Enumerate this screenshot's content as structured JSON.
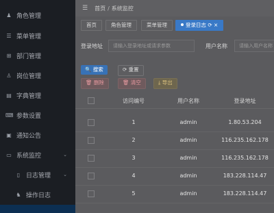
{
  "sidebar": {
    "items": [
      {
        "label": "角色管理",
        "icon": "user-group-icon"
      },
      {
        "label": "菜单管理",
        "icon": "menu-tree-icon"
      },
      {
        "label": "部门管理",
        "icon": "org-icon"
      },
      {
        "label": "岗位管理",
        "icon": "post-icon"
      },
      {
        "label": "字典管理",
        "icon": "dict-icon"
      },
      {
        "label": "参数设置",
        "icon": "settings-icon"
      },
      {
        "label": "通知公告",
        "icon": "notice-icon"
      },
      {
        "label": "系统监控",
        "icon": "monitor-icon"
      },
      {
        "label": "日志管理",
        "icon": "log-icon"
      },
      {
        "label": "操作日志",
        "icon": "operation-log-icon"
      }
    ]
  },
  "topbar": {
    "breadcrumb": [
      "首页",
      "系统监控"
    ]
  },
  "tags": [
    {
      "label": "首页"
    },
    {
      "label": "角色管理"
    },
    {
      "label": "菜单管理"
    },
    {
      "label": "登录日志 ⟳ ×"
    }
  ],
  "search": {
    "account_label": "登录地址",
    "account_placeholder": "请输入登录地址或请求参数",
    "user_label": "用户名称",
    "user_placeholder": "请输入用户名称"
  },
  "actions": {
    "search": "搜索",
    "reset": "重置",
    "delete": "删除",
    "clear": "清空",
    "export": "导出"
  },
  "table": {
    "headers": [
      "访问编号",
      "用户名称",
      "登录地址"
    ],
    "rows": [
      {
        "id": "1",
        "user": "admin",
        "ip": "1.80.53.204"
      },
      {
        "id": "2",
        "user": "admin",
        "ip": "116.235.162.178"
      },
      {
        "id": "3",
        "user": "admin",
        "ip": "116.235.162.178"
      },
      {
        "id": "4",
        "user": "admin",
        "ip": "183.228.114.47"
      },
      {
        "id": "5",
        "user": "admin",
        "ip": "183.228.114.47"
      }
    ]
  }
}
